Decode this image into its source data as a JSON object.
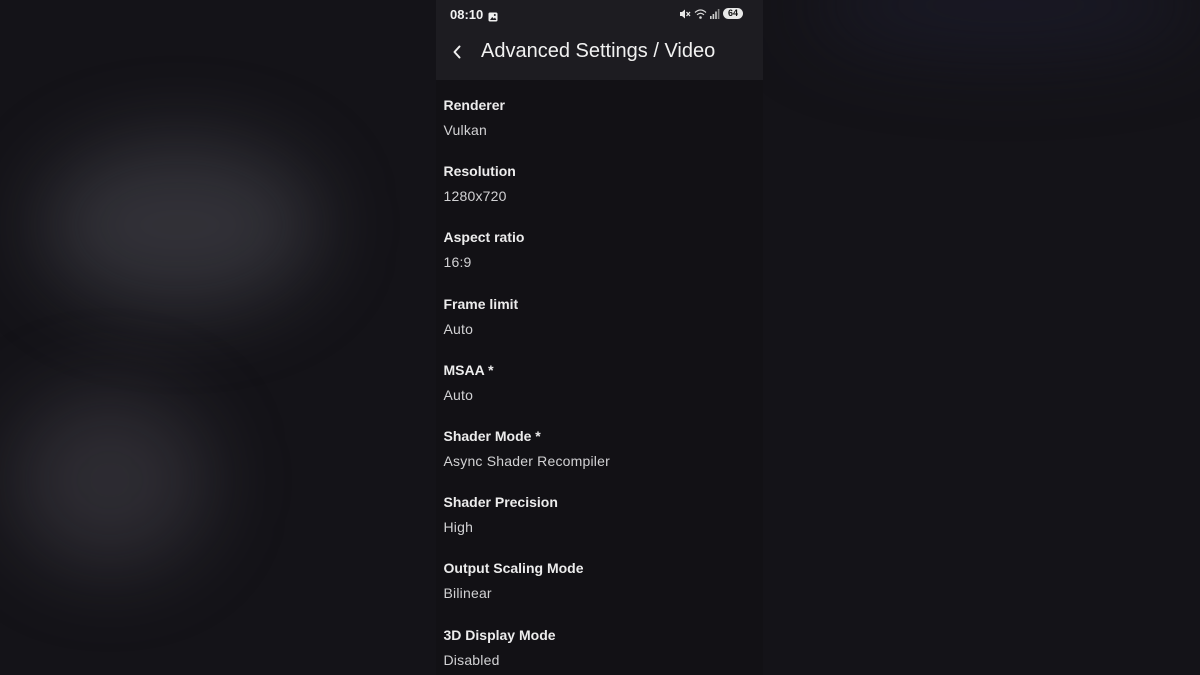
{
  "status_bar": {
    "time": "08:10",
    "battery": "64"
  },
  "header": {
    "title": "Advanced Settings / Video"
  },
  "settings": [
    {
      "label": "Renderer",
      "value": "Vulkan"
    },
    {
      "label": "Resolution",
      "value": "1280x720"
    },
    {
      "label": "Aspect ratio",
      "value": "16:9"
    },
    {
      "label": "Frame limit",
      "value": "Auto"
    },
    {
      "label": "MSAA *",
      "value": "Auto"
    },
    {
      "label": "Shader Mode *",
      "value": "Async Shader Recompiler"
    },
    {
      "label": "Shader Precision",
      "value": "High"
    },
    {
      "label": "Output Scaling Mode",
      "value": "Bilinear"
    },
    {
      "label": "3D Display Mode",
      "value": "Disabled"
    }
  ],
  "icons": {
    "back": "chevron-left-icon",
    "gallery": "image-icon",
    "mute": "mute-icon",
    "wifi": "wifi-icon",
    "signal": "signal-icon"
  },
  "colors": {
    "background": "#131217",
    "header": "#1d1c21",
    "text": "#ececec"
  }
}
